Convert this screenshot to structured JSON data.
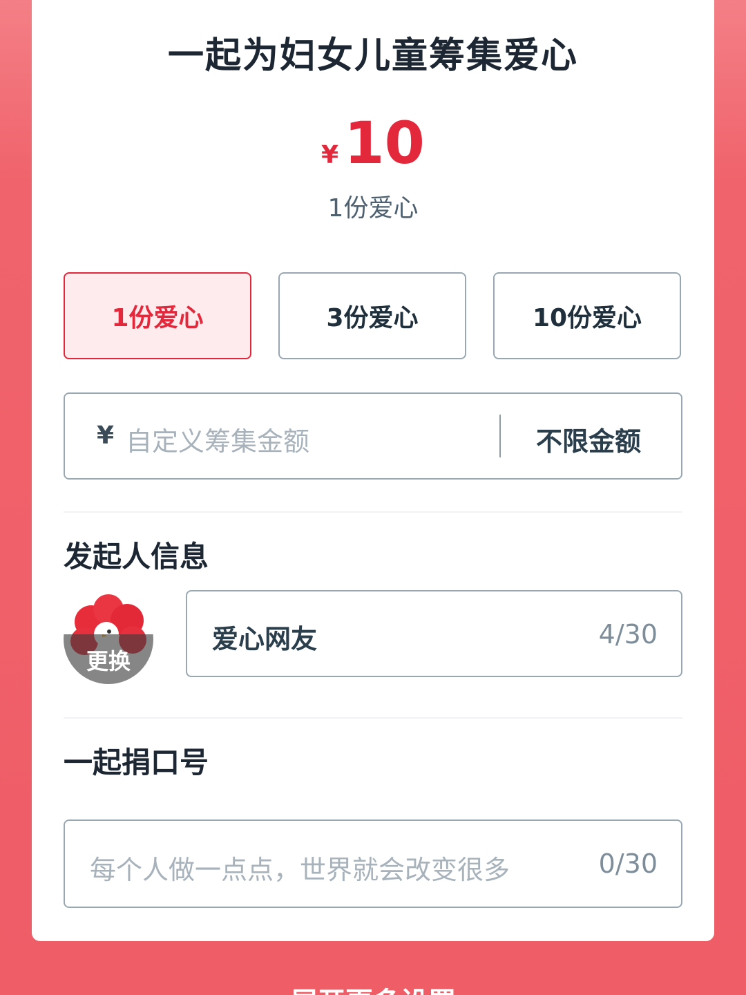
{
  "header": {
    "title": "一起为妇女儿童筹集爱心"
  },
  "amount": {
    "currency": "¥",
    "value": "10",
    "label": "1份爱心"
  },
  "options": [
    {
      "label": "1份爱心",
      "selected": true
    },
    {
      "label": "3份爱心",
      "selected": false
    },
    {
      "label": "10份爱心",
      "selected": false
    }
  ],
  "custom_amount": {
    "currency": "¥",
    "placeholder": "自定义筹集金额",
    "unlimited_label": "不限金额"
  },
  "initiator": {
    "section_title": "发起人信息",
    "change_avatar_label": "更换",
    "name_value": "爱心网友",
    "name_count": "4/30"
  },
  "slogan": {
    "section_title": "一起捐口号",
    "placeholder": "每个人做一点点，世界就会改变很多",
    "count": "0/30"
  },
  "footer": {
    "more_settings_label": "展开更多设置"
  },
  "colors": {
    "accent": "#e3283c",
    "background": "#ef5d67",
    "border": "#98a7b1"
  }
}
